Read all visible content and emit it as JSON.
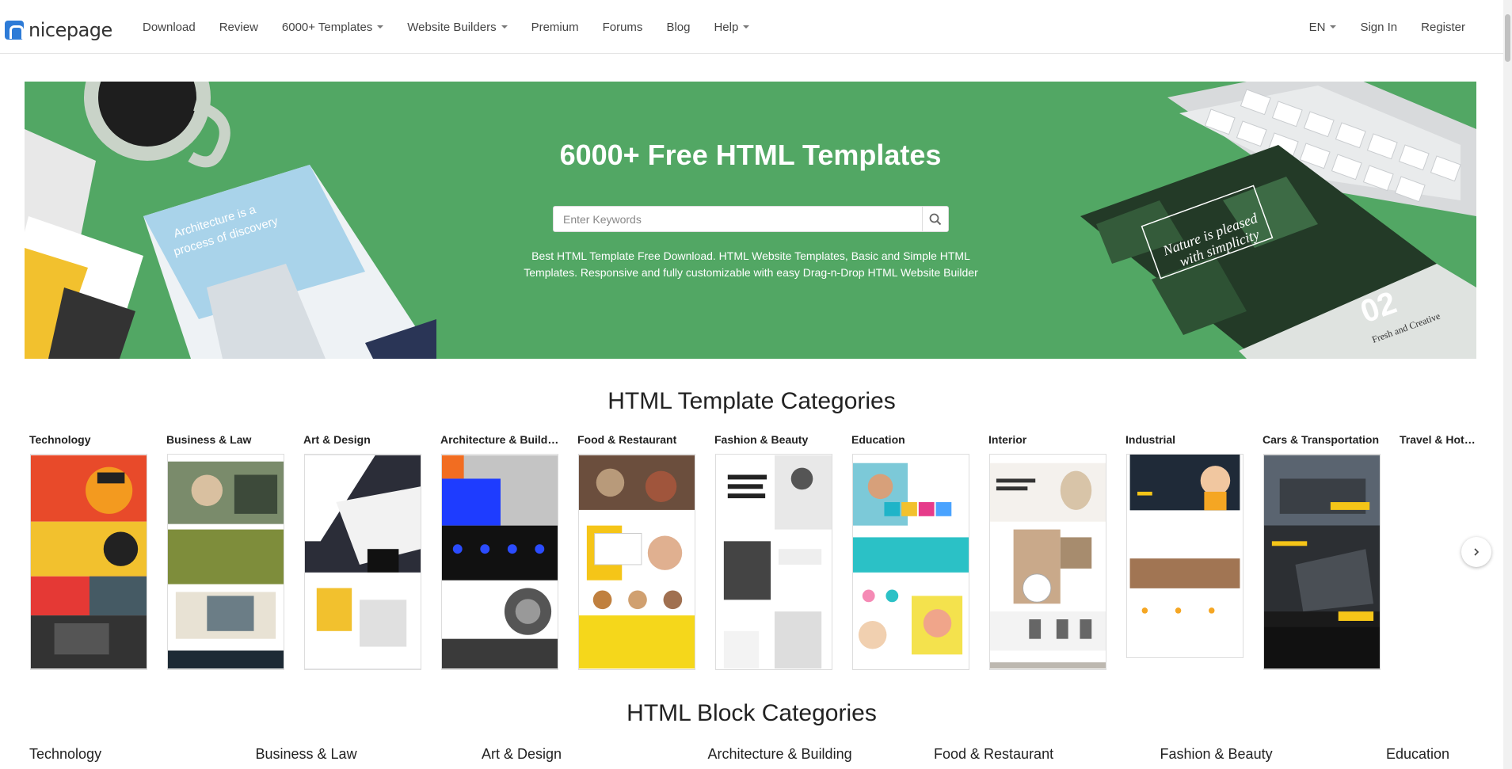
{
  "nav": {
    "logo_text": "nicepage",
    "items": [
      {
        "label": "Download",
        "dropdown": false
      },
      {
        "label": "Review",
        "dropdown": false
      },
      {
        "label": "6000+ Templates",
        "dropdown": true
      },
      {
        "label": "Website Builders",
        "dropdown": true
      },
      {
        "label": "Premium",
        "dropdown": false
      },
      {
        "label": "Forums",
        "dropdown": false
      },
      {
        "label": "Blog",
        "dropdown": false
      },
      {
        "label": "Help",
        "dropdown": true
      }
    ],
    "right": {
      "language": "EN",
      "sign_in": "Sign In",
      "register": "Register"
    }
  },
  "hero": {
    "title": "6000+ Free HTML Templates",
    "search_placeholder": "Enter Keywords",
    "description": "Best HTML Template Free Download. HTML Website Templates, Basic and Simple HTML Templates. Responsive and fully customizable with easy Drag-n-Drop HTML Website Builder",
    "bg_color": "#52a764"
  },
  "template_section": {
    "title": "HTML Template Categories",
    "categories": [
      "Technology",
      "Business & Law",
      "Art & Design",
      "Architecture & Building",
      "Food & Restaurant",
      "Fashion & Beauty",
      "Education",
      "Interior",
      "Industrial",
      "Cars & Transportation",
      "Travel & Hotels"
    ]
  },
  "block_section": {
    "title": "HTML Block Categories",
    "categories": [
      "Technology",
      "Business & Law",
      "Art & Design",
      "Architecture & Building",
      "Food & Restaurant",
      "Fashion & Beauty",
      "Education"
    ]
  },
  "icons": {
    "search": "search-icon",
    "next": "chevron-right-icon"
  }
}
